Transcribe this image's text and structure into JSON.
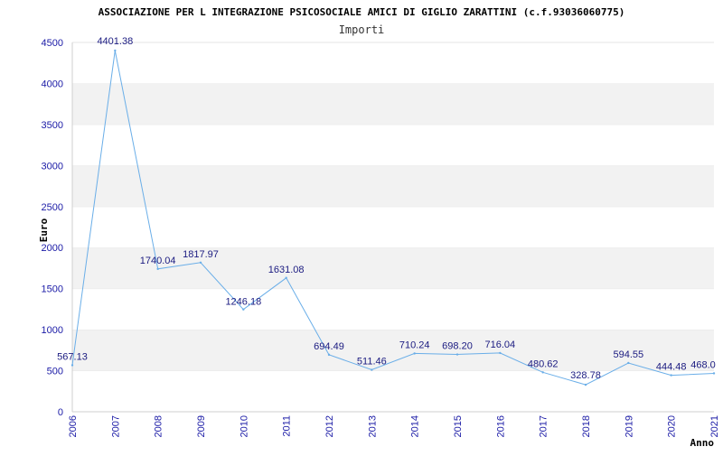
{
  "chart_data": {
    "type": "line",
    "title": "ASSOCIAZIONE PER L INTEGRAZIONE PSICOSOCIALE AMICI DI GIGLIO ZARATTINI (c.f.93036060775)",
    "subtitle": "Importi",
    "xlabel": "Anno",
    "ylabel": "Euro",
    "ylim": [
      0,
      4500
    ],
    "yticks": [
      "0",
      "500",
      "1000",
      "1500",
      "2000",
      "2500",
      "3000",
      "3500",
      "4000",
      "4500"
    ],
    "categories": [
      "2006",
      "2007",
      "2008",
      "2009",
      "2010",
      "2011",
      "2012",
      "2013",
      "2014",
      "2015",
      "2016",
      "2017",
      "2018",
      "2019",
      "2020",
      "2021"
    ],
    "values": [
      567.13,
      4401.38,
      1740.04,
      1817.97,
      1246.18,
      1631.08,
      694.49,
      511.46,
      710.24,
      698.2,
      716.04,
      480.62,
      328.78,
      594.55,
      444.48,
      468.0
    ],
    "data_labels": [
      "567.13",
      "4401.38",
      "1740.04",
      "1817.97",
      "1246.18",
      "1631.08",
      "694.49",
      "511.46",
      "710.24",
      "698.20",
      "716.04",
      "480.62",
      "328.78",
      "594.55",
      "444.48",
      "468.0"
    ],
    "grid": "horizontal alternating bands",
    "colors": {
      "line": "#6aaee8",
      "axis_text": "#1a1aa6",
      "band": "#f2f2f2"
    }
  }
}
